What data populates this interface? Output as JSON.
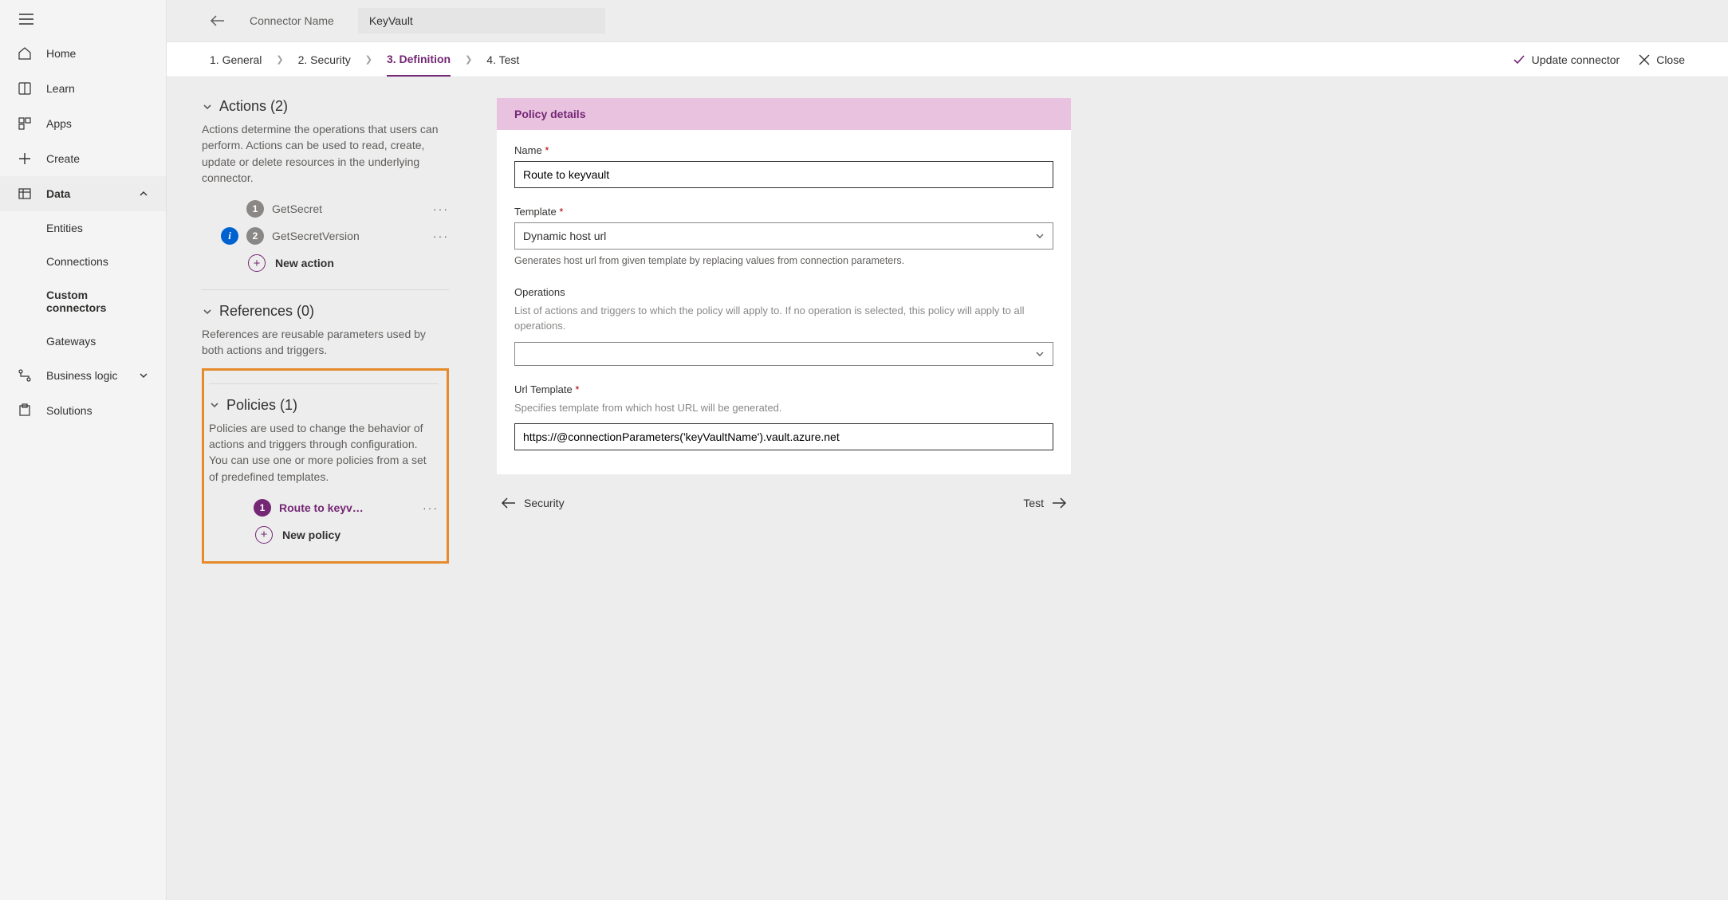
{
  "sidebar": {
    "items": [
      {
        "label": "Home"
      },
      {
        "label": "Learn"
      },
      {
        "label": "Apps"
      },
      {
        "label": "Create"
      },
      {
        "label": "Data"
      },
      {
        "label": "Business logic"
      },
      {
        "label": "Solutions"
      }
    ],
    "subItems": [
      {
        "label": "Entities"
      },
      {
        "label": "Connections"
      },
      {
        "label": "Custom connectors"
      },
      {
        "label": "Gateways"
      }
    ]
  },
  "header": {
    "connectorLabel": "Connector Name",
    "connectorValue": "KeyVault",
    "steps": [
      "1. General",
      "2. Security",
      "3. Definition",
      "4. Test"
    ],
    "updateLabel": "Update connector",
    "closeLabel": "Close"
  },
  "definition": {
    "actions": {
      "title": "Actions (2)",
      "desc": "Actions determine the operations that users can perform. Actions can be used to read, create, update or delete resources in the underlying connector.",
      "items": [
        "GetSecret",
        "GetSecretVersion"
      ],
      "newLabel": "New action"
    },
    "references": {
      "title": "References (0)",
      "desc": "References are reusable parameters used by both actions and triggers."
    },
    "policies": {
      "title": "Policies (1)",
      "desc": "Policies are used to change the behavior of actions and triggers through configuration. You can use one or more policies from a set of predefined templates.",
      "items": [
        "Route to keyv…"
      ],
      "newLabel": "New policy"
    }
  },
  "form": {
    "panelTitle": "Policy details",
    "nameLabel": "Name",
    "nameValue": "Route to keyvault",
    "templateLabel": "Template",
    "templateValue": "Dynamic host url",
    "templateHint": "Generates host url from given template by replacing values from connection parameters.",
    "operationsLabel": "Operations",
    "operationsDesc": "List of actions and triggers to which the policy will apply to. If no operation is selected, this policy will apply to all operations.",
    "urlTemplateLabel": "Url Template",
    "urlTemplateDesc": "Specifies template from which host URL will be generated.",
    "urlTemplateValue": "https://@connectionParameters('keyVaultName').vault.azure.net"
  },
  "footer": {
    "prev": "Security",
    "next": "Test"
  }
}
